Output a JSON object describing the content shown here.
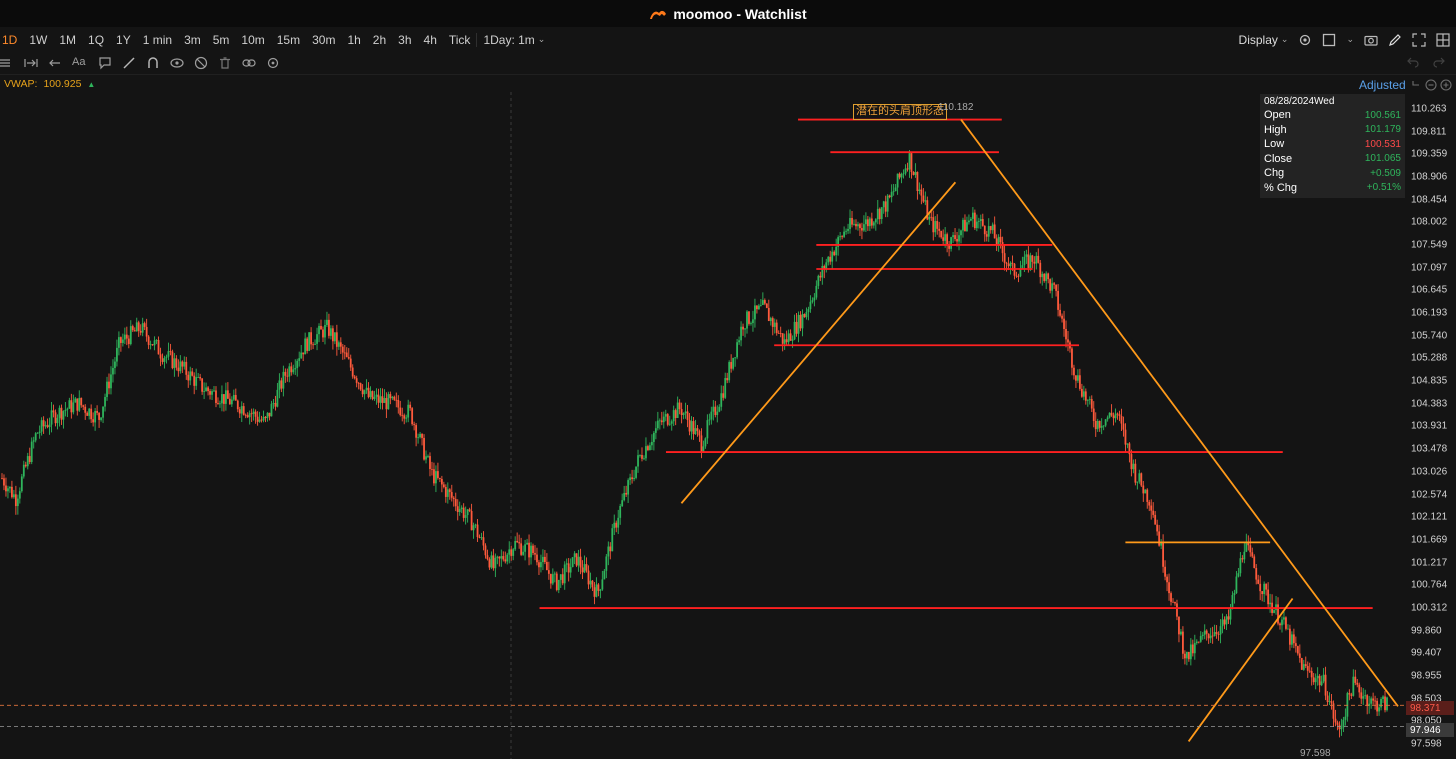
{
  "window": {
    "app_name": "moomoo",
    "title": "moomoo - Watchlist"
  },
  "timeframes": [
    {
      "label": "1D",
      "active": true
    },
    {
      "label": "1W"
    },
    {
      "label": "1M"
    },
    {
      "label": "1Q"
    },
    {
      "label": "1Y"
    },
    {
      "label": "1 min"
    },
    {
      "label": "3m"
    },
    {
      "label": "5m"
    },
    {
      "label": "10m"
    },
    {
      "label": "15m"
    },
    {
      "label": "30m"
    },
    {
      "label": "1h"
    },
    {
      "label": "2h"
    },
    {
      "label": "3h"
    },
    {
      "label": "4h"
    },
    {
      "label": "Tick"
    },
    {
      "label": "1Day: 1m"
    }
  ],
  "toolbar": {
    "display_label": "Display"
  },
  "indicator": {
    "name": "VWAP:",
    "value": "100.925"
  },
  "adjusted_label": "Adjusted",
  "ohlc_panel": {
    "date": "08/28/2024Wed",
    "rows": [
      {
        "label": "Open",
        "value": "100.561",
        "dir": "up"
      },
      {
        "label": "High",
        "value": "101.179",
        "dir": "up"
      },
      {
        "label": "Low",
        "value": "100.531",
        "dir": "dn"
      },
      {
        "label": "Close",
        "value": "101.065",
        "dir": "up"
      },
      {
        "label": "Chg",
        "value": "+0.509",
        "dir": "up"
      },
      {
        "label": "% Chg",
        "value": "+0.51%",
        "dir": "up"
      }
    ]
  },
  "annotation": {
    "text": "潜在的头肩顶形态",
    "peak_price": "110.182",
    "low_price": "97.598"
  },
  "price_tags": {
    "last": "98.371",
    "crosshair": "97.946"
  },
  "y_axis_ticks": [
    "110.263",
    "109.811",
    "109.359",
    "108.906",
    "108.454",
    "108.002",
    "107.549",
    "107.097",
    "106.645",
    "106.193",
    "105.740",
    "105.288",
    "104.835",
    "104.383",
    "103.931",
    "103.478",
    "103.026",
    "102.574",
    "102.121",
    "101.669",
    "101.217",
    "100.764",
    "100.312",
    "99.860",
    "99.407",
    "98.955",
    "98.503",
    "98.050",
    "97.598"
  ],
  "colors": {
    "up": "#2fb55c",
    "down": "#ff5a3c",
    "support_lines": "#ff2020",
    "trend_lines": "#ff9a1a",
    "accent": "#ff8a2b"
  },
  "chart_data": {
    "type": "candlestick",
    "ylim": [
      97.3,
      110.6
    ],
    "horizontal_lines": [
      110.05,
      109.4,
      107.55,
      107.07,
      105.55,
      103.42,
      101.62,
      100.31
    ],
    "trend_lines": [
      {
        "from": [
          0.485,
          102.4
        ],
        "to": [
          0.68,
          108.8
        ]
      },
      {
        "from": [
          0.684,
          110.05
        ],
        "to": [
          0.995,
          98.35
        ]
      },
      {
        "from": [
          0.846,
          97.65
        ],
        "to": [
          0.92,
          100.5
        ]
      }
    ],
    "path": [
      [
        0,
        102.9
      ],
      [
        0.01,
        102.5
      ],
      [
        0.025,
        103.8
      ],
      [
        0.04,
        104.2
      ],
      [
        0.055,
        104.4
      ],
      [
        0.07,
        104.1
      ],
      [
        0.085,
        105.6
      ],
      [
        0.1,
        105.9
      ],
      [
        0.115,
        105.4
      ],
      [
        0.13,
        105.1
      ],
      [
        0.145,
        104.7
      ],
      [
        0.16,
        104.5
      ],
      [
        0.175,
        104.3
      ],
      [
        0.19,
        104.0
      ],
      [
        0.205,
        105.0
      ],
      [
        0.22,
        105.6
      ],
      [
        0.235,
        105.9
      ],
      [
        0.25,
        105.2
      ],
      [
        0.265,
        104.5
      ],
      [
        0.28,
        104.4
      ],
      [
        0.295,
        104.2
      ],
      [
        0.31,
        103.0
      ],
      [
        0.325,
        102.5
      ],
      [
        0.34,
        102.0
      ],
      [
        0.355,
        101.1
      ],
      [
        0.37,
        101.6
      ],
      [
        0.385,
        101.4
      ],
      [
        0.4,
        100.8
      ],
      [
        0.415,
        101.3
      ],
      [
        0.43,
        100.6
      ],
      [
        0.445,
        102.2
      ],
      [
        0.46,
        103.3
      ],
      [
        0.475,
        104.0
      ],
      [
        0.49,
        104.3
      ],
      [
        0.505,
        103.6
      ],
      [
        0.52,
        104.6
      ],
      [
        0.535,
        106.0
      ],
      [
        0.55,
        106.3
      ],
      [
        0.565,
        105.6
      ],
      [
        0.58,
        106.2
      ],
      [
        0.595,
        107.2
      ],
      [
        0.61,
        107.9
      ],
      [
        0.625,
        108.0
      ],
      [
        0.64,
        108.4
      ],
      [
        0.655,
        109.3
      ],
      [
        0.67,
        108.0
      ],
      [
        0.685,
        107.6
      ],
      [
        0.7,
        108.1
      ],
      [
        0.715,
        107.8
      ],
      [
        0.73,
        107.0
      ],
      [
        0.745,
        107.3
      ],
      [
        0.76,
        106.6
      ],
      [
        0.775,
        105.0
      ],
      [
        0.79,
        104.0
      ],
      [
        0.805,
        104.2
      ],
      [
        0.818,
        103.0
      ],
      [
        0.83,
        102.4
      ],
      [
        0.842,
        100.8
      ],
      [
        0.855,
        99.3
      ],
      [
        0.87,
        99.8
      ],
      [
        0.885,
        100.0
      ],
      [
        0.897,
        101.6
      ],
      [
        0.91,
        100.7
      ],
      [
        0.925,
        100.0
      ],
      [
        0.94,
        99.1
      ],
      [
        0.955,
        98.8
      ],
      [
        0.965,
        97.8
      ],
      [
        0.975,
        98.8
      ],
      [
        0.99,
        98.4
      ]
    ]
  }
}
